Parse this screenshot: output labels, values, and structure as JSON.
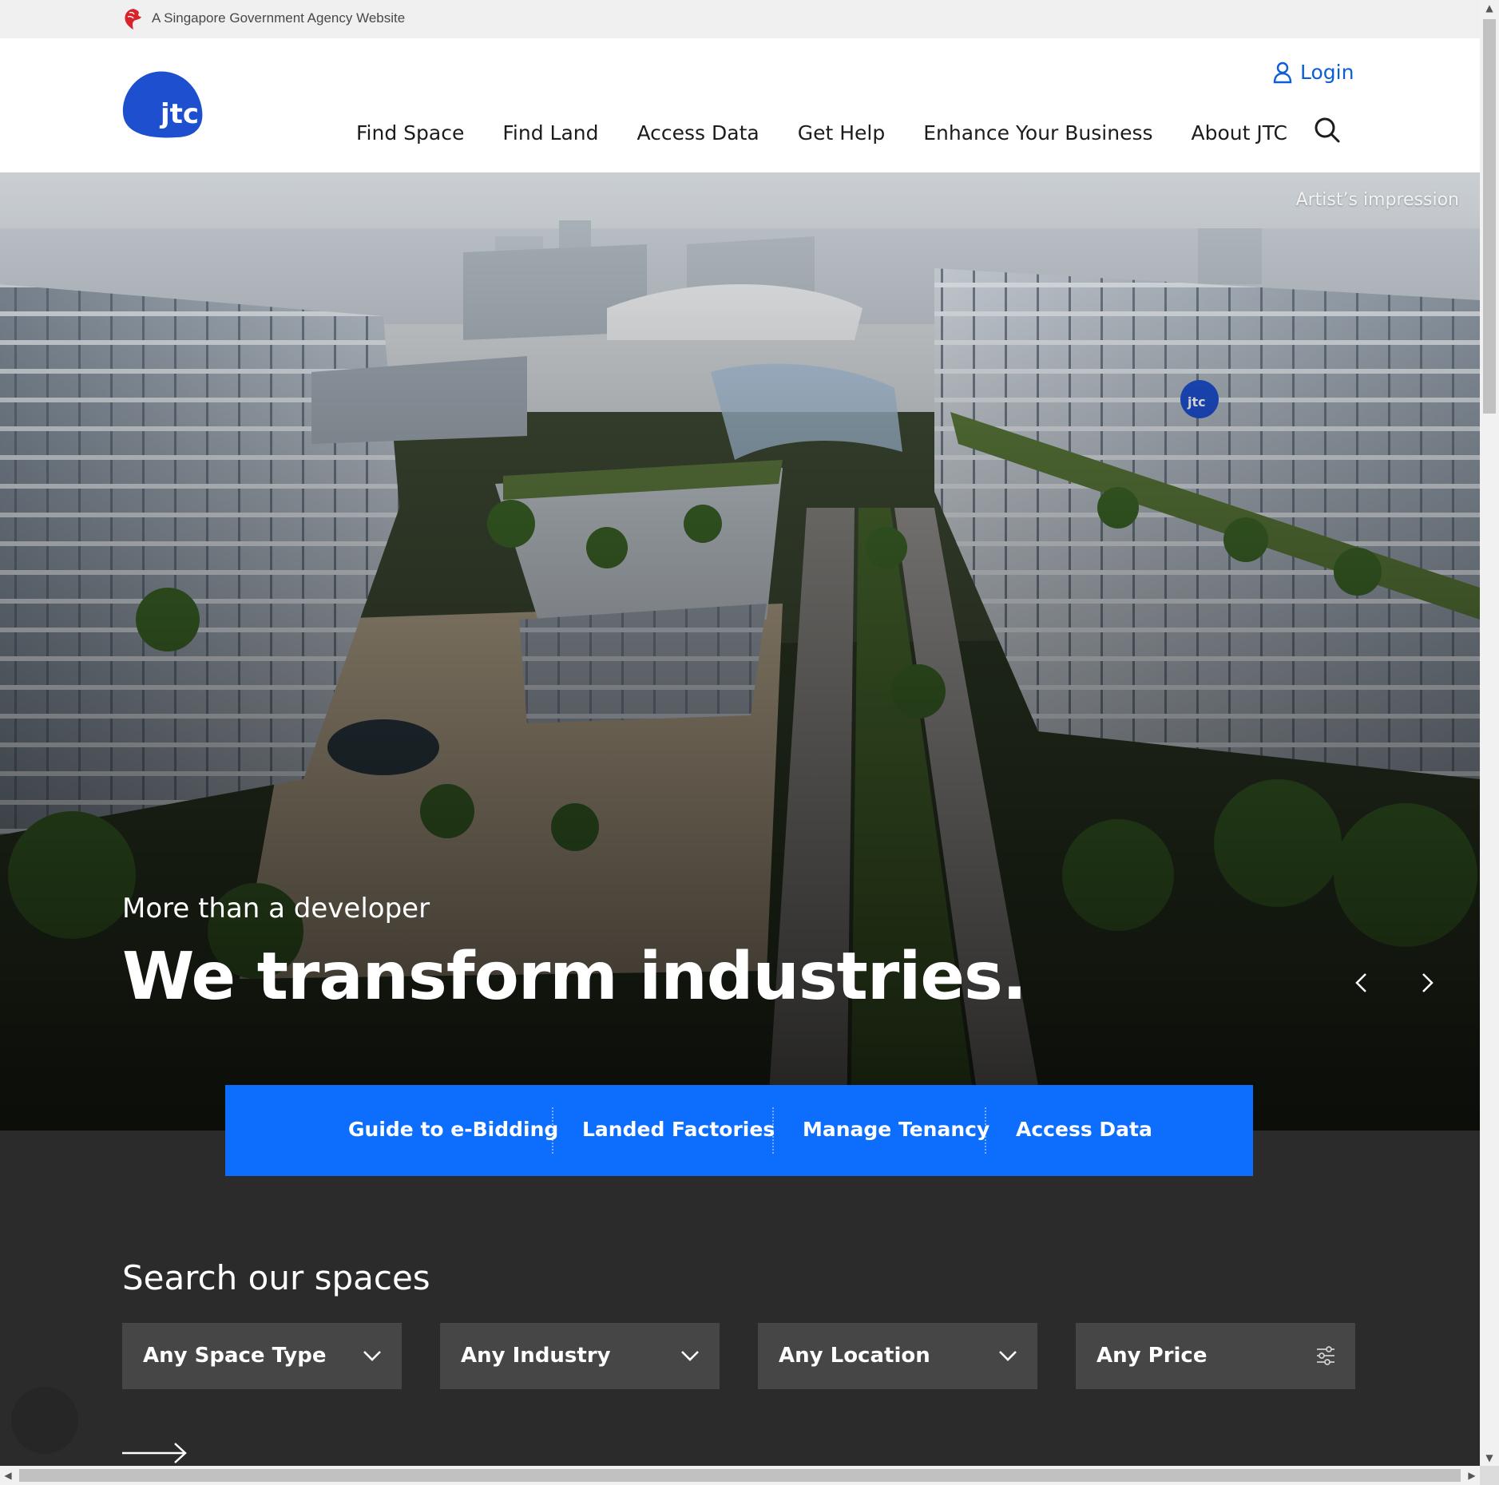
{
  "gov_banner": {
    "text": "A Singapore Government Agency Website"
  },
  "header": {
    "logo_text": "jtc",
    "login_label": "Login",
    "nav": [
      "Find Space",
      "Find Land",
      "Access Data",
      "Get Help",
      "Enhance Your Business",
      "About JTC"
    ]
  },
  "hero": {
    "caption": "Artist’s impression",
    "subtitle": "More than a developer",
    "title": "We transform industries.",
    "logo_on_building": "jtc"
  },
  "quick_links": [
    "Guide to e-Bidding",
    "Landed Factories",
    "Manage Tenancy",
    "Access Data"
  ],
  "search": {
    "title": "Search our spaces",
    "filters": [
      "Any Space Type",
      "Any Industry",
      "Any Location",
      "Any Price"
    ]
  },
  "colors": {
    "brand_blue": "#0d6efd",
    "login_blue": "#0b5ed7",
    "logo_blue": "#1d4fcf",
    "dark_bg": "#2b2b2b",
    "filter_bg": "#464646",
    "lion_red": "#d8232a"
  },
  "icons": {
    "lion": "lion-head-icon",
    "user": "user-icon",
    "search": "search-icon",
    "prev": "chevron-left-icon",
    "next": "chevron-right-icon",
    "dropdown": "chevron-down-icon",
    "sliders": "sliders-icon",
    "arrow": "arrow-right-icon"
  }
}
